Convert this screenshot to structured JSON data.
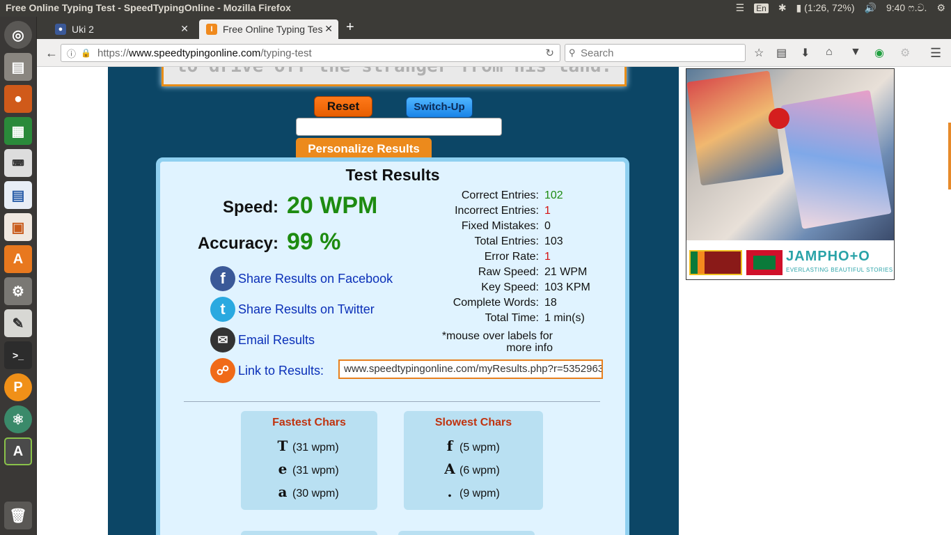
{
  "system": {
    "window_title": "Free Online Typing Test - SpeedTypingOnline - Mozilla Firefox",
    "language": "En",
    "battery": "(1:26, 72%)",
    "clock": "9:40 ෆ.ව."
  },
  "tabs": [
    {
      "label": "Uki 2",
      "active": false
    },
    {
      "label": "Free Online Typing Tes",
      "active": true
    }
  ],
  "navbar": {
    "url_protocol": "https://",
    "url_host": "www.speedtypingonline.com",
    "url_path": "/typing-test",
    "search_placeholder": "Search"
  },
  "typing_area": {
    "visible_text": "to drive off the stranger from his land."
  },
  "controls": {
    "reset_label": "Reset",
    "switchup_label": "Switch-Up",
    "name_value": "",
    "personalize_label": "Personalize Results"
  },
  "results": {
    "title": "Test Results",
    "speed_label": "Speed:",
    "speed_value": "20 WPM",
    "accuracy_label": "Accuracy:",
    "accuracy_value": "99 %",
    "stats": [
      {
        "label": "Correct Entries:",
        "value": "102"
      },
      {
        "label": "Incorrect Entries:",
        "value": "1"
      },
      {
        "label": "Fixed Mistakes:",
        "value": "0"
      },
      {
        "label": "Total Entries:",
        "value": "103"
      },
      {
        "label": "Error Rate:",
        "value": "1"
      },
      {
        "label": "Raw Speed:",
        "value": "21 WPM"
      },
      {
        "label": "Key Speed:",
        "value": "103 KPM"
      },
      {
        "label": "Complete Words:",
        "value": "18"
      },
      {
        "label": "Total Time:",
        "value": "1 min(s)"
      }
    ],
    "mouse_note": "*mouse over labels for more info",
    "share_facebook": "Share Results on Facebook",
    "share_twitter": "Share Results on Twitter",
    "email_results": "Email Results",
    "link_label": "Link to Results:",
    "link_url": "www.speedtypingonline.com/myResults.php?r=5352963",
    "fastest": {
      "title": "Fastest Chars",
      "rows": [
        {
          "char": "T",
          "speed": "(31 wpm)"
        },
        {
          "char": "e",
          "speed": "(31 wpm)"
        },
        {
          "char": "a",
          "speed": "(30 wpm)"
        }
      ]
    },
    "slowest": {
      "title": "Slowest Chars",
      "rows": [
        {
          "char": "f",
          "speed": "(5 wpm)"
        },
        {
          "char": "A",
          "speed": "(6 wpm)"
        },
        {
          "char": ".",
          "speed": "(9 wpm)"
        }
      ]
    }
  },
  "ad": {
    "brand": "JAMPHO+O",
    "tagline": "EVERLASTING BEAUTIFUL STORIES"
  },
  "colors": {
    "accent_orange": "#ec8a1c",
    "page_navy": "#0c4666",
    "value_green": "#1d8b10",
    "error_red": "#d41111"
  },
  "icons": [
    "ubuntu-dash-icon",
    "files-icon",
    "firefox-icon",
    "calc-icon",
    "keyboard-icon",
    "writer-icon",
    "impress-icon",
    "software-center-icon",
    "settings-icon",
    "editor-icon",
    "terminal-icon",
    "pidgin-icon",
    "atom-icon",
    "updater-icon",
    "trash-icon"
  ]
}
